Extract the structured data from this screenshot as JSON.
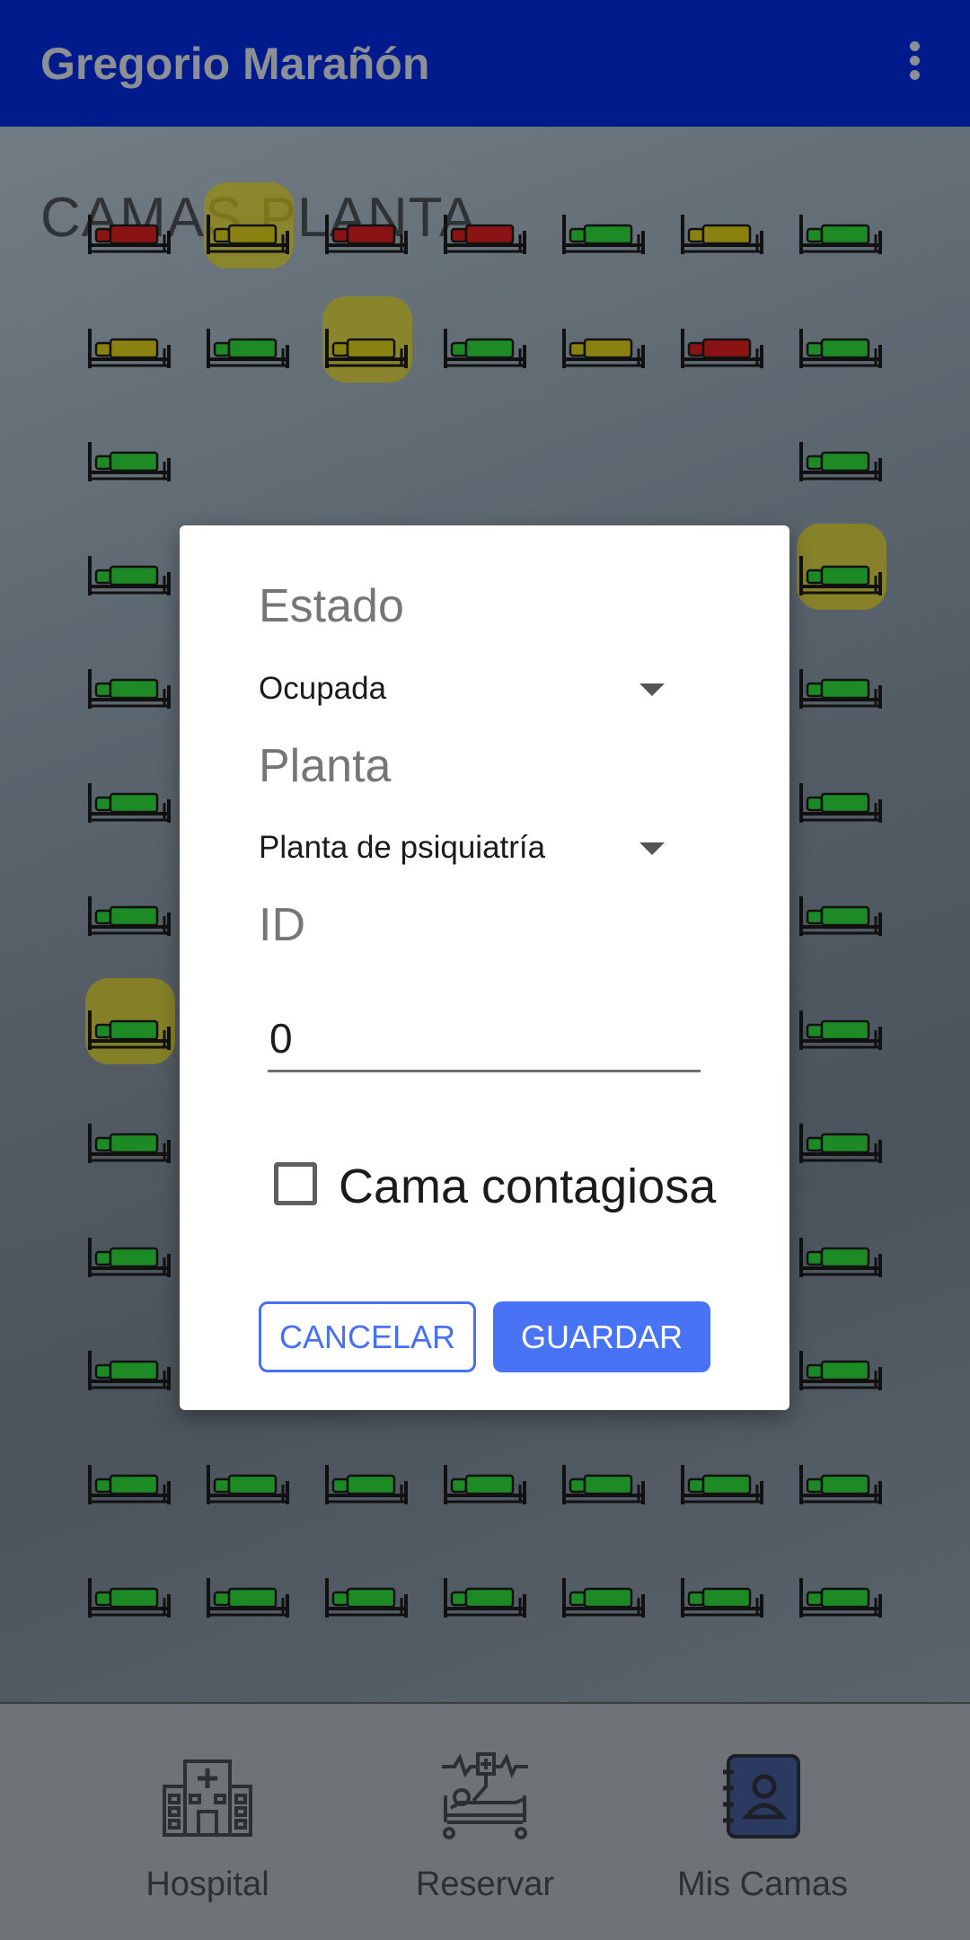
{
  "app_bar": {
    "title": "Gregorio Marañón",
    "menu_icon": "more-vert-icon"
  },
  "page": {
    "title": "CAMAS PLANTA"
  },
  "colors": {
    "red": "#8a1414",
    "yellow": "#8a8210",
    "green": "#1d8a25",
    "highlight": "#8a8214"
  },
  "beds": {
    "rows": [
      [
        "red",
        "yellow-hl",
        "red",
        "red",
        "green",
        "yellow",
        "green"
      ],
      [
        "yellow",
        "green",
        "yellow-hl",
        "green",
        "yellow",
        "red",
        "green"
      ],
      [
        "green",
        null,
        null,
        null,
        null,
        null,
        "green"
      ],
      [
        "green",
        null,
        null,
        null,
        null,
        null,
        "green-hl"
      ],
      [
        "green",
        null,
        null,
        null,
        null,
        null,
        "green"
      ],
      [
        "green",
        null,
        null,
        null,
        null,
        null,
        "green"
      ],
      [
        "green",
        null,
        null,
        null,
        null,
        null,
        "green"
      ],
      [
        "green-hl",
        null,
        null,
        null,
        null,
        null,
        "green"
      ],
      [
        "green",
        null,
        null,
        null,
        null,
        null,
        "green"
      ],
      [
        "green",
        null,
        null,
        null,
        null,
        null,
        "green"
      ],
      [
        "green",
        "yellow",
        "red",
        "green",
        "green",
        "green",
        "green"
      ],
      [
        "green",
        "green",
        "green",
        "green",
        "green",
        "green",
        "green"
      ],
      [
        "green",
        "green",
        "green",
        "green",
        "green",
        "green",
        "green"
      ]
    ]
  },
  "dialog": {
    "estado_label": "Estado",
    "estado_value": "Ocupada",
    "planta_label": "Planta",
    "planta_value": "Planta de psiquiatría",
    "id_label": "ID",
    "id_value": "0",
    "contagious_label": "Cama contagiosa",
    "contagious_checked": false,
    "cancel_label": "CANCELAR",
    "save_label": "GUARDAR"
  },
  "bottom_nav": {
    "items": [
      {
        "label": "Hospital",
        "icon": "hospital-icon"
      },
      {
        "label": "Reservar",
        "icon": "hospital-bed-icon"
      },
      {
        "label": "Mis Camas",
        "icon": "contacts-book-icon"
      }
    ]
  }
}
